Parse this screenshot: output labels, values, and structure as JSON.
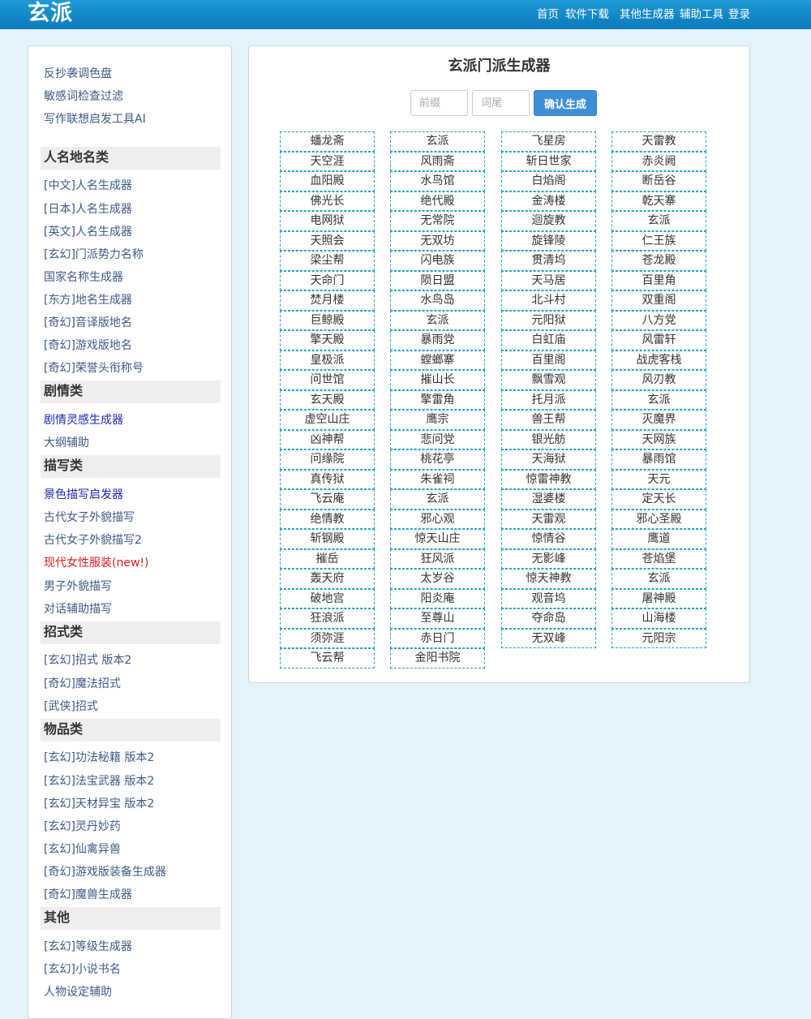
{
  "header": {
    "logo": "玄派",
    "nav": [
      "首页",
      "软件下载",
      "其他生成器",
      "辅助工具",
      "登录"
    ]
  },
  "sidebar": {
    "top_links": [
      "反抄袭调色盘",
      "敏感词检查过滤",
      "写作联想启发工具AI"
    ],
    "sections": [
      {
        "title": "人名地名类",
        "items": [
          "[中文]人名生成器",
          "[日本]人名生成器",
          "[英文]人名生成器",
          "[玄幻]门派势力名称",
          "国家名称生成器",
          "[东方]地名生成器",
          "[奇幻]音译版地名",
          "[奇幻]游戏版地名",
          "[奇幻]荣誉头衔称号"
        ]
      },
      {
        "title": "剧情类",
        "items": [
          "剧情灵感生成器",
          "大纲辅助"
        ]
      },
      {
        "title": "描写类",
        "items": [
          "景色描写启发器",
          "古代女子外貌描写",
          "古代女子外貌描写2",
          "现代女性服装(new!)",
          "男子外貌描写",
          "对话辅助描写"
        ]
      },
      {
        "title": "招式类",
        "items": [
          "[玄幻]招式 版本2",
          "[奇幻]魔法招式",
          "[武侠]招式"
        ]
      },
      {
        "title": "物品类",
        "items": [
          "[玄幻]功法秘籍 版本2",
          "[玄幻]法宝武器 版本2",
          "[玄幻]天材异宝 版本2",
          "[玄幻]灵丹妙药",
          "[玄幻]仙禽异兽",
          "[奇幻]游戏版装备生成器",
          "[奇幻]魔兽生成器"
        ]
      },
      {
        "title": "其他",
        "items": [
          "[玄幻]等级生成器",
          "[玄幻]小说书名",
          "人物设定辅助"
        ]
      }
    ]
  },
  "main": {
    "title": "玄派门派生成器",
    "prefix_placeholder": "前缀",
    "suffix_placeholder": "词尾",
    "generate_label": "确认生成",
    "columns": [
      [
        "蟠龙斋",
        "天空涯",
        "血阳殿",
        "佛光长",
        "电网狱",
        "天照会",
        "梁尘帮",
        "天命门",
        "焚月楼",
        "巨鲸殿",
        "擎天殿",
        "皇极派",
        "问世馆",
        "玄天殿",
        "虚空山庄",
        "凶神帮",
        "问缘院",
        "真传狱",
        "飞云庵",
        "绝情教",
        "斩钢殿",
        "摧岳",
        "轰天府",
        "破地宫",
        "狂浪派",
        "须弥涯",
        "飞云帮"
      ],
      [
        "玄派",
        "风雨斋",
        "水鸟馆",
        "绝代殿",
        "无常院",
        "无双坊",
        "闪电族",
        "陨日盟",
        "水鸟岛",
        "玄派",
        "暴雨党",
        "螳螂寨",
        "摧山长",
        "擎雷角",
        "鹰宗",
        "悲问党",
        "桃花亭",
        "朱雀祠",
        "玄派",
        "邪心观",
        "惊天山庄",
        "狂风派",
        "太岁谷",
        "阳炎庵",
        "至尊山",
        "赤日门",
        "金阳书院"
      ],
      [
        "飞星房",
        "斩日世家",
        "白焰阁",
        "金涛楼",
        "迴旋教",
        "旋锋陵",
        "贯清坞",
        "天马居",
        "北斗村",
        "元阳狱",
        "白虹庙",
        "百里阁",
        "飘雪观",
        "托月派",
        "兽王帮",
        "银光舫",
        "天海狱",
        "惊雷神教",
        "湿婆楼",
        "天雷观",
        "惊情谷",
        "无影峰",
        "惊天神教",
        "观音坞",
        "夺命岛",
        "无双峰"
      ],
      [
        "天雷教",
        "赤炎阙",
        "断岳谷",
        "乾天寨",
        "玄派",
        "仁王族",
        "苍龙殿",
        "百里角",
        "双重阁",
        "八方党",
        "风雷轩",
        "战虎客栈",
        "风刃教",
        "玄派",
        "灭魔界",
        "天网族",
        "暴雨馆",
        "天元",
        "定天长",
        "邪心圣殿",
        "鹰道",
        "苍焰堡",
        "玄派",
        "屠神殿",
        "山海楼",
        "元阳宗"
      ]
    ]
  }
}
